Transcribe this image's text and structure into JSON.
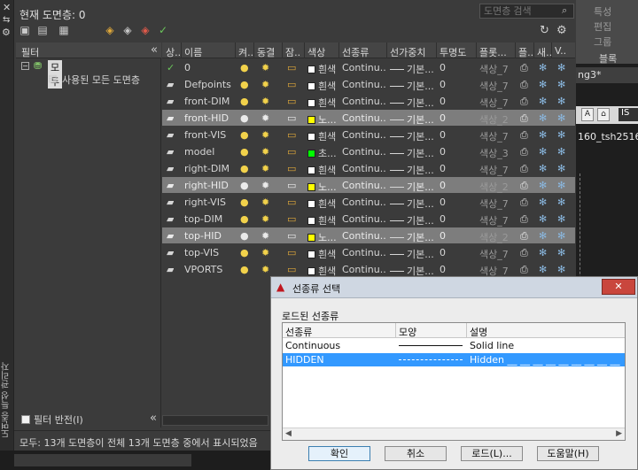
{
  "palette": {
    "current_layer": "현재 도면층: 0",
    "search_placeholder": "도면층 검색",
    "vertical_title": "도면층 특성 관리자",
    "status": "모두: 13개 도면층이 전체 13개 도면층 중에서 표시되었음"
  },
  "filters": {
    "header": "필터",
    "collapse_glyph": "«",
    "all_label": "모두",
    "used_label": "사용된 모든 도면층",
    "invert_label": "필터 반전(I)"
  },
  "columns": [
    "상..",
    "이름",
    "켜..",
    "동결",
    "잠..",
    "색상",
    "선종류",
    "선가중치",
    "투명도",
    "플롯...",
    "플..",
    "새..",
    "V.."
  ],
  "layers": [
    {
      "name": "0",
      "color": "흰색",
      "color_hex": "#ffffff",
      "linetype": "Continu...",
      "lineweight": "기본...",
      "transparency": "0",
      "plot_style": "색상_7",
      "selected": false,
      "current": true
    },
    {
      "name": "Defpoints",
      "color": "흰색",
      "color_hex": "#ffffff",
      "linetype": "Continu...",
      "lineweight": "기본...",
      "transparency": "0",
      "plot_style": "색상_7",
      "selected": false,
      "current": false
    },
    {
      "name": "front-DIM",
      "color": "흰색",
      "color_hex": "#ffffff",
      "linetype": "Continu...",
      "lineweight": "기본...",
      "transparency": "0",
      "plot_style": "색상_7",
      "selected": false,
      "current": false
    },
    {
      "name": "front-HID",
      "color": "노...",
      "color_hex": "#ffff00",
      "linetype": "Continu...",
      "lineweight": "기본...",
      "transparency": "0",
      "plot_style": "색상_2",
      "selected": true,
      "current": false
    },
    {
      "name": "front-VIS",
      "color": "흰색",
      "color_hex": "#ffffff",
      "linetype": "Continu...",
      "lineweight": "기본...",
      "transparency": "0",
      "plot_style": "색상_7",
      "selected": false,
      "current": false
    },
    {
      "name": "model",
      "color": "초...",
      "color_hex": "#00ff00",
      "linetype": "Continu...",
      "lineweight": "기본...",
      "transparency": "0",
      "plot_style": "색상_3",
      "selected": false,
      "current": false
    },
    {
      "name": "right-DIM",
      "color": "흰색",
      "color_hex": "#ffffff",
      "linetype": "Continu...",
      "lineweight": "기본...",
      "transparency": "0",
      "plot_style": "색상_7",
      "selected": false,
      "current": false
    },
    {
      "name": "right-HID",
      "color": "노...",
      "color_hex": "#ffff00",
      "linetype": "Continu...",
      "lineweight": "기본...",
      "transparency": "0",
      "plot_style": "색상_2",
      "selected": true,
      "current": false
    },
    {
      "name": "right-VIS",
      "color": "흰색",
      "color_hex": "#ffffff",
      "linetype": "Continu...",
      "lineweight": "기본...",
      "transparency": "0",
      "plot_style": "색상_7",
      "selected": false,
      "current": false
    },
    {
      "name": "top-DIM",
      "color": "흰색",
      "color_hex": "#ffffff",
      "linetype": "Continu...",
      "lineweight": "기본...",
      "transparency": "0",
      "plot_style": "색상_7",
      "selected": false,
      "current": false
    },
    {
      "name": "top-HID",
      "color": "노...",
      "color_hex": "#ffff00",
      "linetype": "Continu...",
      "lineweight": "기본...",
      "transparency": "0",
      "plot_style": "색상_2",
      "selected": true,
      "current": false
    },
    {
      "name": "top-VIS",
      "color": "흰색",
      "color_hex": "#ffffff",
      "linetype": "Continu...",
      "lineweight": "기본...",
      "transparency": "0",
      "plot_style": "색상_7",
      "selected": false,
      "current": false
    },
    {
      "name": "VPORTS",
      "color": "흰색",
      "color_hex": "#ffffff",
      "linetype": "Continu...",
      "lineweight": "기본...",
      "transparency": "0",
      "plot_style": "색상_7",
      "selected": false,
      "current": false
    }
  ],
  "right_panel": {
    "ribbon_items": [
      "특성",
      "편집",
      "그룹"
    ],
    "block_label": "블록",
    "doc_tab": "ng3*",
    "iso_label": "IS",
    "file_label": "160_tsh2516"
  },
  "dialog": {
    "title": "선종류 선택",
    "close_glyph": "✕",
    "loaded_label": "로드된 선종류",
    "columns": [
      "선종류",
      "모양",
      "설명"
    ],
    "linetypes": [
      {
        "name": "Continuous",
        "description": "Solid line",
        "selected": false
      },
      {
        "name": "HIDDEN",
        "description": "Hidden __ __ __ __ __ __ __ __ __ __ __ __ __ __ __",
        "selected": true
      }
    ],
    "buttons": {
      "ok": "확인",
      "cancel": "취소",
      "load": "로드(L)...",
      "help": "도움말(H)"
    }
  },
  "colors": {
    "palette_bg": "#3b3b3b",
    "selected_row": "#7d7d7d",
    "dialog_selection": "#3399ff"
  }
}
